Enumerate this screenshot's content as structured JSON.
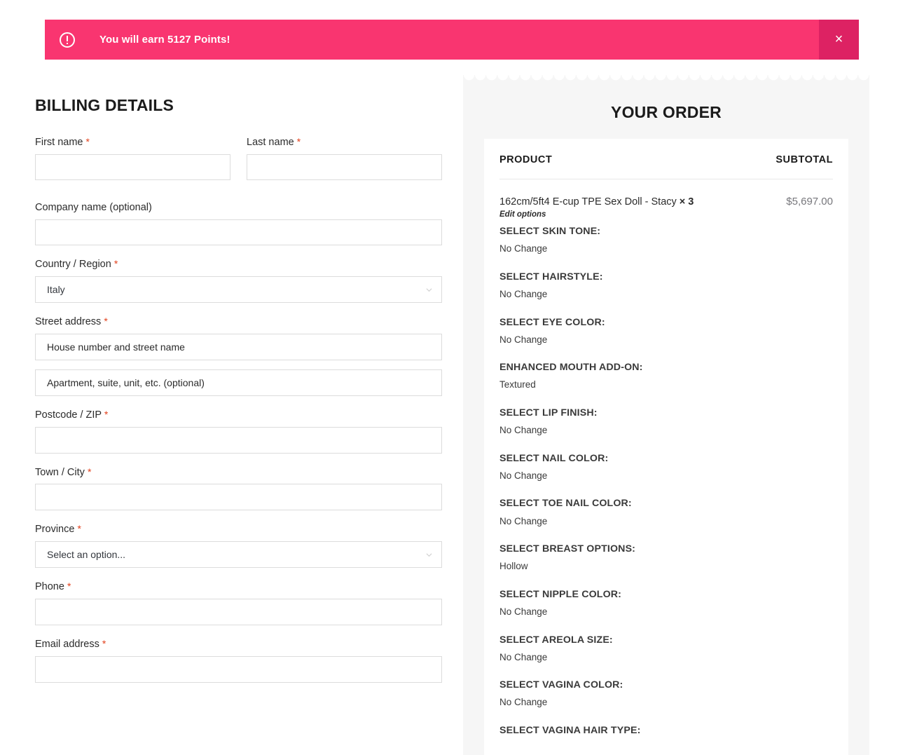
{
  "banner": {
    "icon": "exclamation-circle-icon",
    "text_before": "You will earn ",
    "points": "5127",
    "text_after": " Points!",
    "close_label": "×",
    "background_color": "#f93570",
    "close_background_color": "#dd2263"
  },
  "billing": {
    "title": "BILLING DETAILS",
    "required_mark": "*",
    "fields": {
      "first_name": {
        "label": "First name",
        "value": "",
        "placeholder": ""
      },
      "last_name": {
        "label": "Last name",
        "value": "",
        "placeholder": ""
      },
      "company": {
        "label": "Company name (optional)",
        "value": "",
        "placeholder": ""
      },
      "country": {
        "label": "Country / Region",
        "value": "Italy"
      },
      "street": {
        "label": "Street address",
        "placeholder": "House number and street name",
        "value": ""
      },
      "street2": {
        "placeholder": "Apartment, suite, unit, etc. (optional)",
        "value": ""
      },
      "postcode": {
        "label": "Postcode / ZIP",
        "value": "",
        "placeholder": ""
      },
      "city": {
        "label": "Town / City",
        "value": "",
        "placeholder": ""
      },
      "province": {
        "label": "Province",
        "value": "Select an option..."
      },
      "phone": {
        "label": "Phone",
        "value": "",
        "placeholder": ""
      },
      "email": {
        "label": "Email address",
        "value": "",
        "placeholder": ""
      }
    }
  },
  "order": {
    "title": "YOUR ORDER",
    "columns": {
      "product": "PRODUCT",
      "subtotal": "SUBTOTAL"
    },
    "item": {
      "name": "162cm/5ft4 E-cup TPE Sex Doll - Stacy",
      "quantity": "× 3",
      "price": "$5,697.00",
      "edit_link": "Edit options"
    },
    "options": [
      {
        "label": "SELECT SKIN TONE:",
        "value": "No Change"
      },
      {
        "label": "SELECT HAIRSTYLE:",
        "value": "No Change"
      },
      {
        "label": "SELECT EYE COLOR:",
        "value": "No Change"
      },
      {
        "label": "ENHANCED MOUTH ADD-ON:",
        "value": "Textured"
      },
      {
        "label": "SELECT LIP FINISH:",
        "value": "No Change"
      },
      {
        "label": "SELECT NAIL COLOR:",
        "value": "No Change"
      },
      {
        "label": "SELECT TOE NAIL COLOR:",
        "value": "No Change"
      },
      {
        "label": "SELECT BREAST OPTIONS:",
        "value": "Hollow"
      },
      {
        "label": "SELECT NIPPLE COLOR:",
        "value": "No Change"
      },
      {
        "label": "SELECT AREOLA SIZE:",
        "value": "No Change"
      },
      {
        "label": "SELECT VAGINA COLOR:",
        "value": "No Change"
      },
      {
        "label": "SELECT VAGINA HAIR TYPE:",
        "value": ""
      }
    ]
  }
}
